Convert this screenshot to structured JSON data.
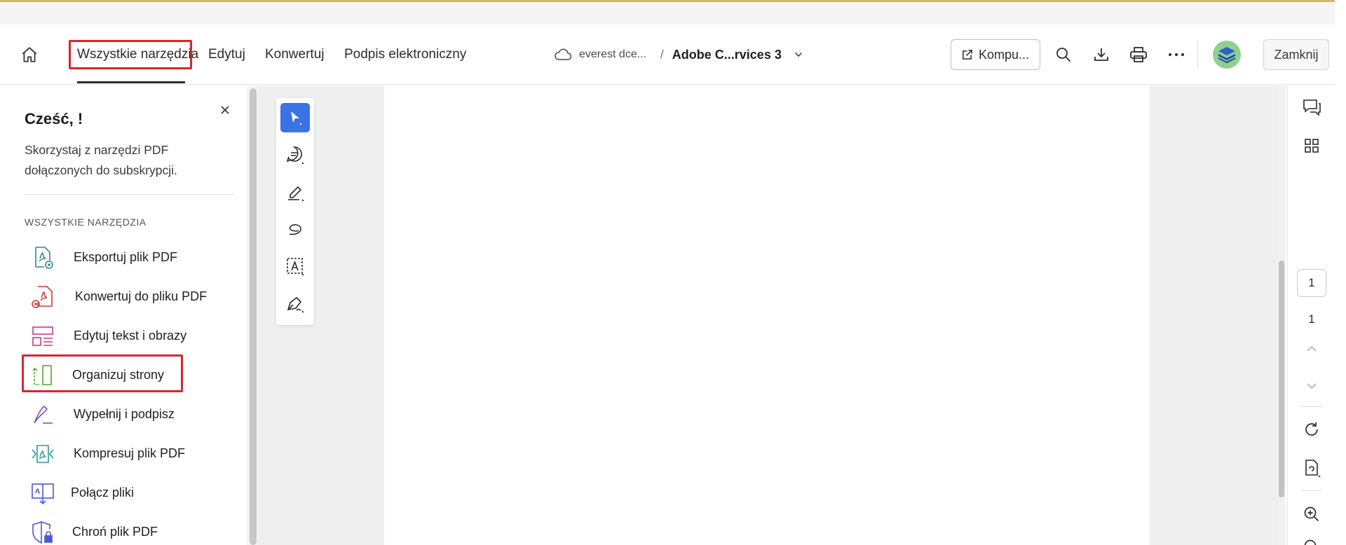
{
  "header": {
    "nav": {
      "all_tools": "Wszystkie narzędzia",
      "edit": "Edytuj",
      "convert": "Konwertuj",
      "e_signature": "Podpis elektroniczny"
    },
    "breadcrumb": {
      "cloud_folder": "everest dce...",
      "separator": "/",
      "file_name": "Adobe C...rvices 3"
    },
    "open_in_desktop_label": "Kompu...",
    "close_label": "Zamknij"
  },
  "left_panel": {
    "greeting": "Cześć, !",
    "subtitle": "Skorzystaj z narzędzi PDF dołączonych do subskrypcji.",
    "section_label": "WSZYSTKIE NARZĘDZIA",
    "tools": [
      {
        "label": "Eksportuj plik PDF",
        "color": "#2f8c8c"
      },
      {
        "label": "Konwertuj do pliku PDF",
        "color": "#d33a3a"
      },
      {
        "label": "Edytuj tekst i obrazy",
        "color": "#c8388c"
      },
      {
        "label": "Organizuj strony",
        "color": "#5aa532"
      },
      {
        "label": "Wypełnij i podpisz",
        "color": "#7b4fc9"
      },
      {
        "label": "Kompresuj plik PDF",
        "color": "#2a9c9c"
      },
      {
        "label": "Połącz pliki",
        "color": "#4a5ad1"
      },
      {
        "label": "Chroń plik PDF",
        "color": "#4a5ad1"
      }
    ]
  },
  "page_nav": {
    "current_page": "1",
    "total_pages": "1"
  },
  "colors": {
    "accent_blue": "#3b73e6",
    "highlight_red": "#d9262c",
    "top_border_gold": "#d7b56d"
  }
}
